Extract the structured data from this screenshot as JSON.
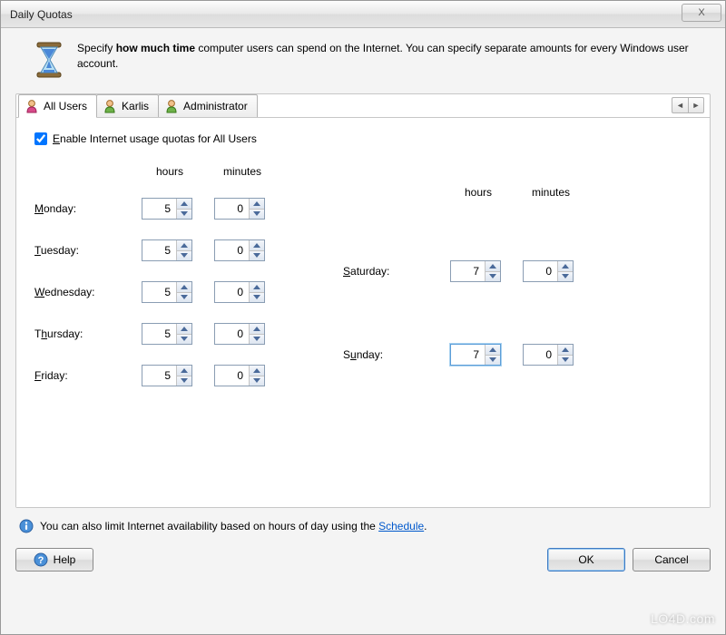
{
  "window": {
    "title": "Daily Quotas",
    "close_symbol": "X"
  },
  "intro": {
    "text_before_bold": "Specify ",
    "bold": "how much time",
    "text_after_bold": " computer users can spend on the Internet. You can specify separate amounts for every Windows user account."
  },
  "tabs": {
    "items": [
      {
        "label": "All Users",
        "icon_color": "#d84a8a"
      },
      {
        "label": "Karlis",
        "icon_color": "#6fb24a"
      },
      {
        "label": "Administrator",
        "icon_color": "#6fb24a"
      }
    ],
    "scroll_left": "◄",
    "scroll_right": "►"
  },
  "checkbox": {
    "checked": true,
    "label_prefix": "",
    "accel": "E",
    "label_rest": "nable Internet usage quotas for All Users"
  },
  "headers": {
    "hours": "hours",
    "minutes": "minutes"
  },
  "weekdays": [
    {
      "accel": "M",
      "rest": "onday:",
      "hours": "5",
      "minutes": "0"
    },
    {
      "accel": "T",
      "rest": "uesday:",
      "hours": "5",
      "minutes": "0"
    },
    {
      "accel": "W",
      "rest": "ednesday:",
      "hours": "5",
      "minutes": "0"
    },
    {
      "pre": "T",
      "accel": "h",
      "rest": "ursday:",
      "hours": "5",
      "minutes": "0"
    },
    {
      "accel": "F",
      "rest": "riday:",
      "hours": "5",
      "minutes": "0"
    }
  ],
  "weekend": [
    {
      "accel": "S",
      "rest": "aturday:",
      "hours": "7",
      "minutes": "0"
    },
    {
      "pre": "S",
      "accel": "u",
      "rest": "nday:",
      "hours": "7",
      "minutes": "0",
      "focused": true
    }
  ],
  "footer": {
    "text_before": "You can also limit Internet availability based on hours of day using the ",
    "link": "Schedule",
    "text_after": "."
  },
  "buttons": {
    "help": "Help",
    "ok": "OK",
    "cancel": "Cancel"
  },
  "watermark": "LO4D.com"
}
